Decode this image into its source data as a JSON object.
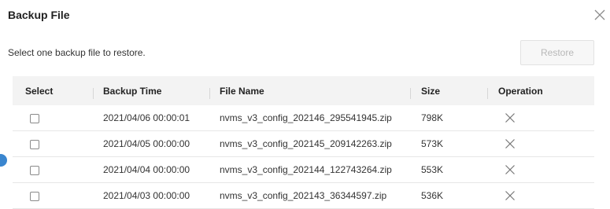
{
  "dialog": {
    "title": "Backup File",
    "instruction": "Select one backup file to restore.",
    "restore_label": "Restore"
  },
  "table": {
    "headers": {
      "select": "Select",
      "backup_time": "Backup Time",
      "file_name": "File Name",
      "size": "Size",
      "operation": "Operation"
    },
    "rows": [
      {
        "backup_time": "2021/04/06 00:00:01",
        "file_name": "nvms_v3_config_202146_295541945.zip",
        "size": "798K"
      },
      {
        "backup_time": "2021/04/05 00:00:00",
        "file_name": "nvms_v3_config_202145_209142263.zip",
        "size": "573K"
      },
      {
        "backup_time": "2021/04/04 00:00:00",
        "file_name": "nvms_v3_config_202144_122743264.zip",
        "size": "553K"
      },
      {
        "backup_time": "2021/04/03 00:00:00",
        "file_name": "nvms_v3_config_202143_36344597.zip",
        "size": "536K"
      }
    ]
  },
  "icons": {
    "close": "close-icon",
    "delete": "delete-icon"
  },
  "colors": {
    "header_bg": "#f3f3f3",
    "disabled_text": "#b8b8b8",
    "accent": "#3a86cf"
  }
}
